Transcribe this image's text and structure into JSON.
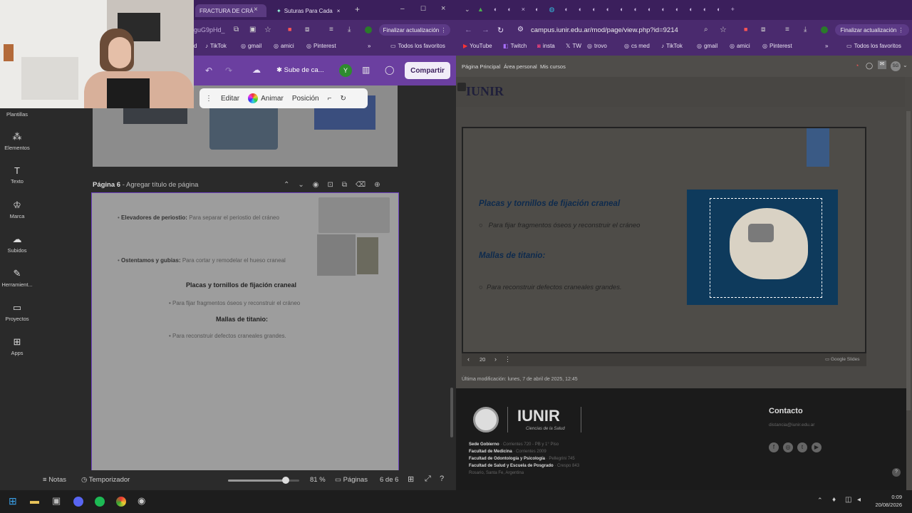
{
  "left_browser": {
    "tabs": [
      "FRACTURA DE CRÁ",
      "Suturas Para Cada"
    ],
    "address": "guG9pHd_",
    "update_button": "Finalizar actualización",
    "bookmarks": [
      "d",
      "TikTok",
      "gmail",
      "amici",
      "Pinterest"
    ],
    "favorites": "Todos los favoritos"
  },
  "canva": {
    "upload_label": "Sube de ca...",
    "avatar_letter": "Y",
    "share_button": "Compartir",
    "float_toolbar": {
      "edit": "Editar",
      "animate": "Animar",
      "position": "Posición"
    },
    "sidebar": [
      {
        "label": "Plantillas",
        "icon": "templates-icon"
      },
      {
        "label": "Elementos",
        "icon": "elements-icon"
      },
      {
        "label": "Texto",
        "icon": "text-icon"
      },
      {
        "label": "Marca",
        "icon": "brand-icon"
      },
      {
        "label": "Subidos",
        "icon": "uploads-icon"
      },
      {
        "label": "Herramient...",
        "icon": "tools-icon"
      },
      {
        "label": "Proyectos",
        "icon": "projects-icon"
      },
      {
        "label": "Apps",
        "icon": "apps-icon"
      }
    ],
    "page_header": {
      "page": "Página 6",
      "placeholder": "Agregar título de página"
    },
    "doc": {
      "item1_bold": "Elevadores de periostio:",
      "item1_text": "Para separar el periostio del cráneo",
      "item2_bold": "Ostentamos y gubias:",
      "item2_text": "Para cortar y remodelar el hueso craneal",
      "heading1": "Placas y tornillos de fijación craneal",
      "item3_text": "Para fijar fragmentos óseos y reconstruir el cráneo",
      "heading2": "Mallas de titanio:",
      "item4_text": "Para reconstruir defectos craneales grandes."
    },
    "bottom": {
      "notes": "Notas",
      "timer": "Temporizador",
      "zoom": "81 %",
      "pages": "Páginas",
      "page_count": "6 de 6",
      "zoom_fraction": 0.81
    }
  },
  "right_browser": {
    "address": "campus.iunir.edu.ar/mod/page/view.php?id=9214",
    "update_button": "Finalizar actualización",
    "bookmarks": [
      "YouTube",
      "Twitch",
      "insta",
      "TW",
      "trovo",
      "cs med",
      "TikTok",
      "gmail",
      "amici",
      "Pinterest"
    ],
    "favorites": "Todos los favoritos",
    "moodle_nav": [
      "Página Principal",
      "Área personal",
      "Mis cursos"
    ],
    "user_initials": "SG",
    "logo_text": "IUNIR",
    "slide": {
      "heading1": "Placas y tornillos de fijación craneal",
      "bullet1": "Para fijar fragmentos óseos y reconstruir el cráneo",
      "heading2": "Mallas de titanio:",
      "bullet2": "Para reconstruir defectos craneales grandes.",
      "page_number": "20",
      "brand": "Google Slides"
    },
    "last_modified": "Última modificación: lunes, 7 de abril de 2025, 12:45",
    "footer": {
      "logo": "IUNIR",
      "tagline": "Ciencias de la Salud",
      "contact_title": "Contacto",
      "email": "distancia@iunir.edu.ar",
      "addresses": [
        {
          "bold": "Sede Gobierno",
          "text": "Corrientes 720 - PB y 1° Piso"
        },
        {
          "bold": "Facultad de Medicina",
          "text": "Corrientes 2009"
        },
        {
          "bold": "Facultad de Odontología y Psicología",
          "text": "Pellegrini 745"
        },
        {
          "bold": "Facultad de Salud y Escuela de Posgrado",
          "text": "Crespo 843"
        },
        {
          "bold": "",
          "text": "Rosario, Santa Fe, Argentina"
        }
      ]
    }
  },
  "taskbar": {
    "time": "0:09",
    "date": "20/08/2026"
  }
}
